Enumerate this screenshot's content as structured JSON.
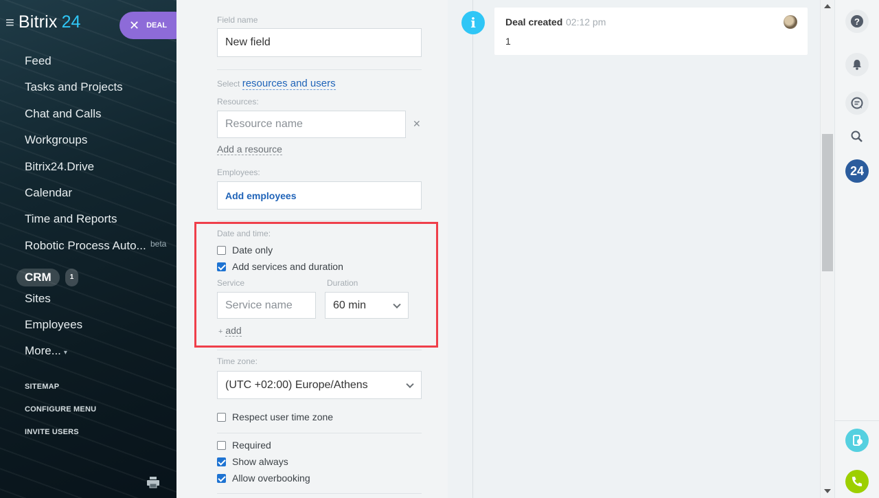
{
  "sidebar": {
    "logo_text": "Bitrix",
    "logo_num": "24",
    "deal_button": "DEAL",
    "nav": [
      {
        "label": "Feed"
      },
      {
        "label": "Tasks and Projects"
      },
      {
        "label": "Chat and Calls"
      },
      {
        "label": "Workgroups"
      },
      {
        "label": "Bitrix24.Drive"
      },
      {
        "label": "Calendar"
      },
      {
        "label": "Time and Reports"
      },
      {
        "label": "Robotic Process Auto...",
        "badge": "beta"
      },
      {
        "label": "CRM",
        "count": "1"
      },
      {
        "label": "Sites"
      },
      {
        "label": "Employees"
      },
      {
        "label": "More..."
      }
    ],
    "system_links": [
      "SITEMAP",
      "CONFIGURE MENU",
      "INVITE USERS"
    ]
  },
  "form": {
    "field_name_label": "Field name",
    "field_name_value": "New field",
    "select_prefix": "Select",
    "select_link": "resources and users",
    "resources_label": "Resources:",
    "resource_placeholder": "Resource name",
    "add_resource": "Add a resource",
    "employees_label": "Employees:",
    "add_employees": "Add employees",
    "date_time_label": "Date and time:",
    "date_only": "Date only",
    "add_services": "Add services and duration",
    "service_label": "Service",
    "duration_label": "Duration",
    "service_placeholder": "Service name",
    "duration_value": "60 min",
    "add_plus": "+",
    "add_link": "add",
    "time_zone_label": "Time zone:",
    "time_zone_value": "(UTC +02:00) Europe/Athens",
    "respect_tz": "Respect user time zone",
    "required": "Required",
    "show_always": "Show always",
    "allow_overbooking": "Allow overbooking",
    "checks": {
      "date_only": false,
      "add_services": true,
      "respect_tz": false,
      "required": false,
      "show_always": true,
      "allow_overbooking": true
    }
  },
  "timeline": {
    "title": "Deal created",
    "time": "02:12 pm",
    "body": "1"
  },
  "rightbar": {
    "badge": "24"
  },
  "colors": {
    "accent": "#2fc6f6",
    "link": "#1f63b8",
    "highlight": "#ef3f4a",
    "deal_button": "#8d6bd8"
  }
}
